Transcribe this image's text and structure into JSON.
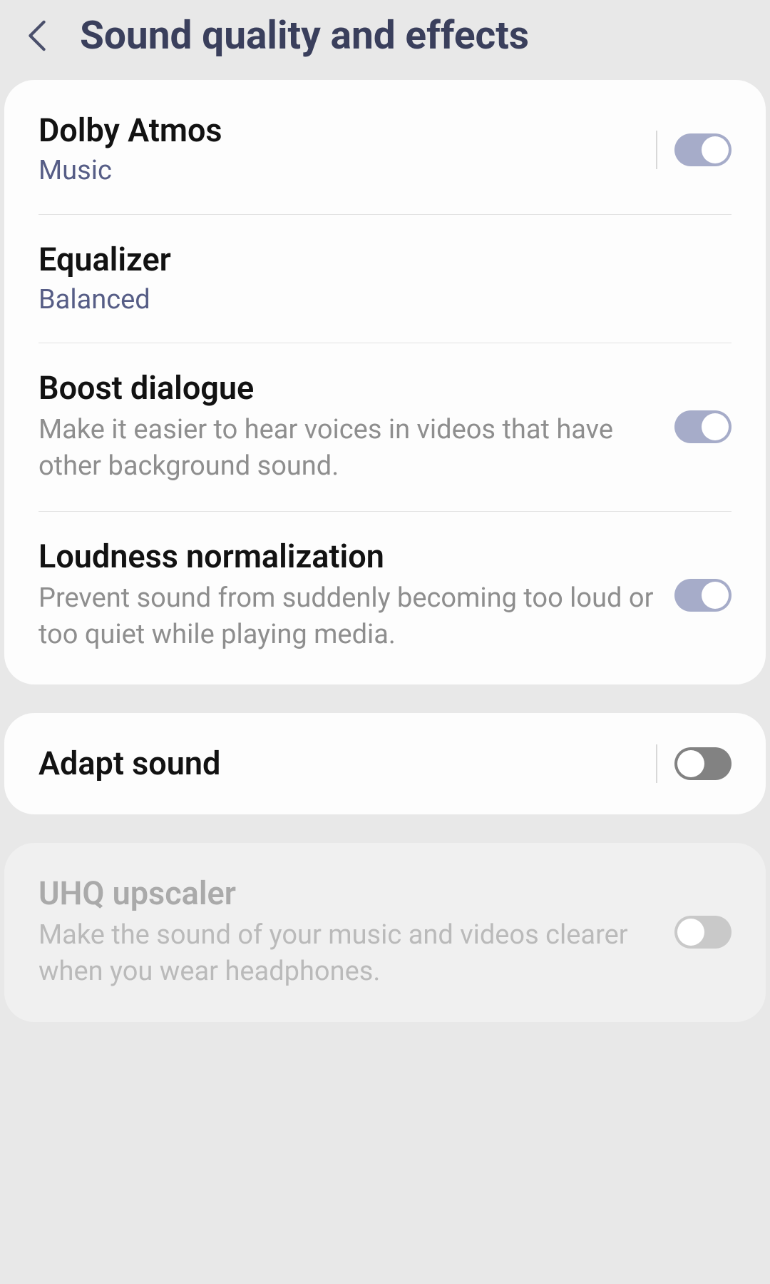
{
  "header": {
    "title": "Sound quality and effects"
  },
  "group1": {
    "dolby": {
      "title": "Dolby Atmos",
      "subtitle": "Music"
    },
    "equalizer": {
      "title": "Equalizer",
      "subtitle": "Balanced"
    },
    "boost": {
      "title": "Boost dialogue",
      "desc": "Make it easier to hear voices in videos that have other background sound."
    },
    "loudness": {
      "title": "Loudness normalization",
      "desc": "Prevent sound from suddenly becoming too loud or too quiet while playing media."
    }
  },
  "group2": {
    "adapt": {
      "title": "Adapt sound"
    }
  },
  "group3": {
    "uhq": {
      "title": "UHQ upscaler",
      "desc": "Make the sound of your music and videos clearer when you wear headphones."
    }
  }
}
